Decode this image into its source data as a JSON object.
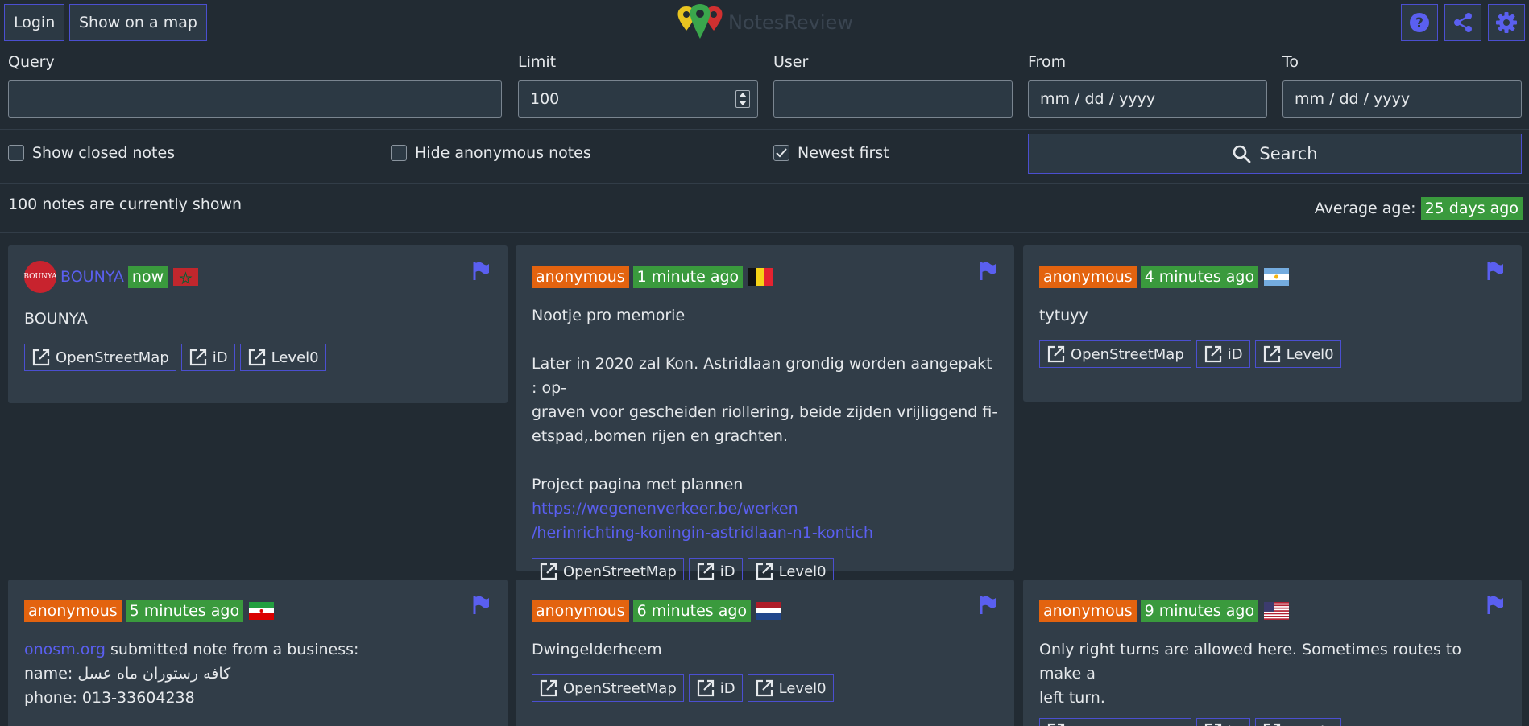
{
  "header": {
    "login_label": "Login",
    "map_label": "Show on a map",
    "app_title": "NotesReview",
    "icons": [
      "help-icon",
      "share-icon",
      "settings-icon"
    ]
  },
  "form": {
    "query_label": "Query",
    "query_value": "",
    "limit_label": "Limit",
    "limit_value": "100",
    "user_label": "User",
    "user_value": "",
    "from_label": "From",
    "from_placeholder": "mm / dd / yyyy",
    "to_label": "To",
    "to_placeholder": "mm / dd / yyyy",
    "show_closed_label": "Show closed notes",
    "show_closed_checked": false,
    "hide_anon_label": "Hide anonymous notes",
    "hide_anon_checked": false,
    "newest_first_label": "Newest first",
    "newest_first_checked": true,
    "search_label": "Search"
  },
  "status": {
    "shown_text": "100 notes are currently shown",
    "avg_label": "Average age:",
    "avg_value": "25 days ago"
  },
  "link_labels": {
    "osm": "OpenStreetMap",
    "id": "iD",
    "level0": "Level0"
  },
  "notes": [
    {
      "user": "BOUNYA",
      "avatar_text": "BOUNYA",
      "age": "now",
      "country_flag": "morocco-flag-icon",
      "body": [
        "BOUNYA"
      ]
    },
    {
      "user": "anonymous",
      "age": "1 minute ago",
      "country_flag": "belgium-flag-icon",
      "body_title": "Nootje pro memorie",
      "body_p1": "Later in 2020 zal Kon. Astridlaan grondig worden aangepakt : op-",
      "body_p2": "graven voor gescheiden riollering, beide zijden vrijliggend fi-",
      "body_p3": "etspad,.bomen rijen en grachten.",
      "body_p4": "Project pagina met plannen ",
      "body_link1": "https://wegenenverkeer.be/werken",
      "body_link2": "/herinrichting-koningin-astridlaan-n1-kontich"
    },
    {
      "user": "anonymous",
      "age": "4 minutes ago",
      "country_flag": "argentina-flag-icon",
      "body": [
        "tytuyy"
      ]
    },
    {
      "user": "anonymous",
      "age": "5 minutes ago",
      "country_flag": "iran-flag-icon",
      "body_link": "onosm.org",
      "body_l1": " submitted note from a business:",
      "body_l2": "name: کافه رستوران ماه عسل",
      "body_l3": "phone: 013-33604238"
    },
    {
      "user": "anonymous",
      "age": "6 minutes ago",
      "country_flag": "netherlands-flag-icon",
      "body": [
        "Dwingelderheem"
      ]
    },
    {
      "user": "anonymous",
      "age": "9 minutes ago",
      "country_flag": "usa-flag-icon",
      "body_l1": "Only right turns are allowed here. Sometimes routes to make a",
      "body_l2": "left turn."
    }
  ],
  "colors": {
    "accent": "#4b4fd0",
    "orange": "#e3630f",
    "green": "#3a9a3d",
    "bg": "#222b33",
    "card": "#313d48"
  }
}
